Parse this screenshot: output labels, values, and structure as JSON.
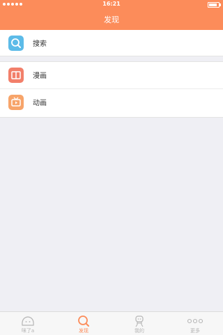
{
  "status_bar": {
    "time": "16:21",
    "signal_icon": "signal-dots-icon",
    "battery_icon": "battery-icon"
  },
  "header": {
    "title": "发现"
  },
  "colors": {
    "accent": "#fc8c5a",
    "search_icon_bg": "#5cbbe8",
    "comic_icon_bg": "#f27f6a",
    "anime_icon_bg": "#f7a46a",
    "background": "#efeff4"
  },
  "menu": {
    "search": {
      "label": "搜索",
      "icon": "search-icon"
    },
    "comic": {
      "label": "漫画",
      "icon": "book-icon"
    },
    "anime": {
      "label": "动画",
      "icon": "tv-icon"
    }
  },
  "tabbar": {
    "items": [
      {
        "label": "咪了a",
        "icon": "face-icon",
        "active": false
      },
      {
        "label": "发现",
        "icon": "search-icon",
        "active": true
      },
      {
        "label": "我的",
        "icon": "robot-icon",
        "active": false
      },
      {
        "label": "更多",
        "icon": "more-icon",
        "active": false
      }
    ]
  }
}
